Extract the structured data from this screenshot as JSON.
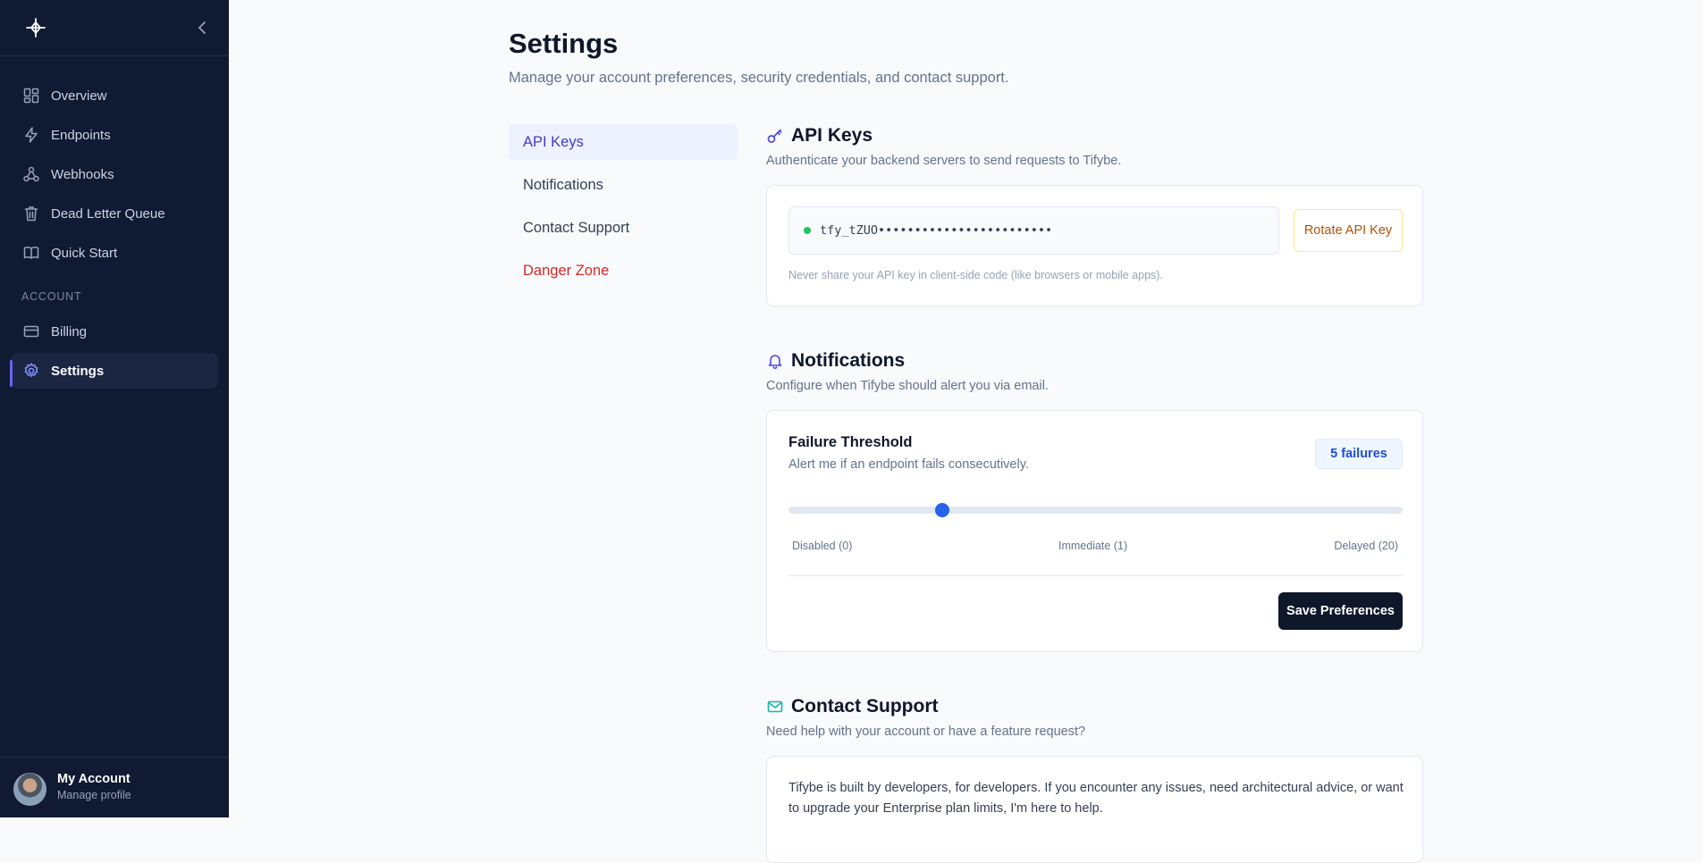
{
  "sidebar": {
    "collapse_glyph": "‹",
    "nav": [
      {
        "label": "Overview",
        "icon": "overview-icon"
      },
      {
        "label": "Endpoints",
        "icon": "bolt-icon"
      },
      {
        "label": "Webhooks",
        "icon": "webhook-icon"
      },
      {
        "label": "Dead Letter Queue",
        "icon": "trash-icon"
      },
      {
        "label": "Quick Start",
        "icon": "book-icon"
      }
    ],
    "section_label": "ACCOUNT",
    "account_nav": [
      {
        "label": "Billing",
        "icon": "card-icon"
      },
      {
        "label": "Settings",
        "icon": "gear-icon",
        "active": true
      }
    ],
    "account": {
      "name": "My Account",
      "subtitle": "Manage profile"
    }
  },
  "page": {
    "title": "Settings",
    "subtitle": "Manage your account preferences, security credentials, and contact support."
  },
  "subnav": [
    {
      "label": "API Keys",
      "active": true
    },
    {
      "label": "Notifications"
    },
    {
      "label": "Contact Support"
    },
    {
      "label": "Danger Zone",
      "danger": true
    }
  ],
  "api_keys": {
    "title": "API Keys",
    "description": "Authenticate your backend servers to send requests to Tifybe.",
    "key_value": "tfy_tZUO••••••••••••••••••••••••",
    "status_color": "#22c55e",
    "rotate_label": "Rotate API Key",
    "hint": "Never share your API key in client-side code (like browsers or mobile apps)."
  },
  "notifications": {
    "title": "Notifications",
    "description": "Configure when Tifybe should alert you via email.",
    "threshold_title": "Failure Threshold",
    "threshold_desc": "Alert me if an endpoint fails consecutively.",
    "badge": "5 failures",
    "slider": {
      "value": 5,
      "min": 0,
      "max": 20
    },
    "ticks": [
      "Disabled (0)",
      "Immediate (1)",
      "Delayed (20)"
    ],
    "save_label": "Save Preferences"
  },
  "support": {
    "title": "Contact Support",
    "description": "Need help with your account or have a feature request?",
    "body": "Tifybe is built by developers, for developers. If you encounter any issues, need architectural advice, or want to upgrade your Enterprise plan limits, I'm here to help."
  },
  "colors": {
    "accent": "#6366f1",
    "sidebar_bg": "#111a33",
    "primary": "#2563eb",
    "danger": "#dc2626",
    "warning": "#b45309"
  }
}
